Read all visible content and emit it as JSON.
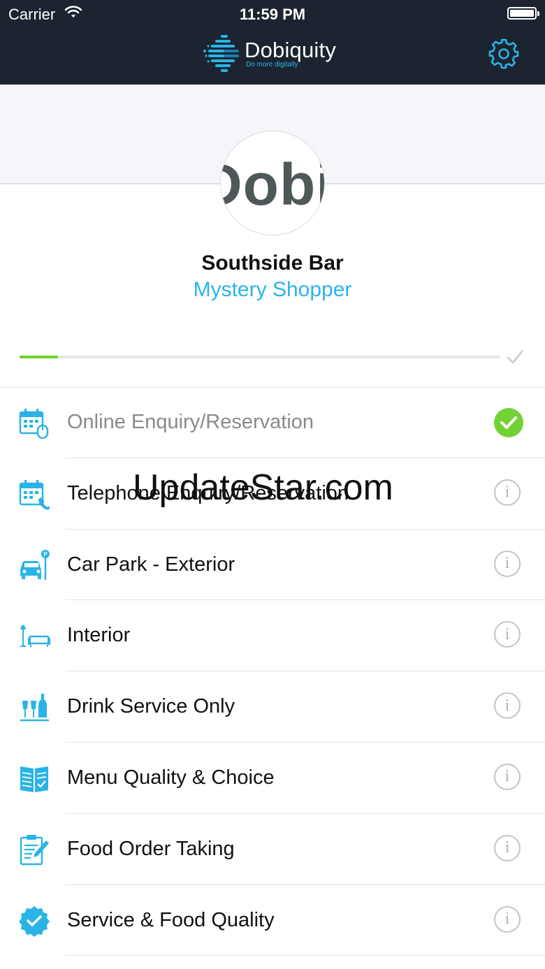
{
  "status_bar": {
    "carrier": "Carrier",
    "time": "11:59 PM"
  },
  "header": {
    "brand_name": "Dobiquity",
    "brand_tagline": "Do more digitally",
    "settings_icon": "gear-icon"
  },
  "profile": {
    "logo_text": "Dobi",
    "venue_name": "Southside Bar",
    "survey_name": "Mystery Shopper"
  },
  "progress": {
    "fraction_complete": 0.08,
    "complete_icon": "checkmark-icon"
  },
  "sections": [
    {
      "label": "Online Enquiry/Reservation",
      "icon": "calendar-mouse-icon",
      "status": "complete",
      "status_icon": "checkmark-circle-icon"
    },
    {
      "label": "Telephone Enquiry/Reservation",
      "icon": "calendar-phone-icon",
      "status": "info",
      "status_icon": "info-icon"
    },
    {
      "label": "Car Park - Exterior",
      "icon": "car-parking-icon",
      "status": "info",
      "status_icon": "info-icon"
    },
    {
      "label": "Interior",
      "icon": "lamp-sofa-icon",
      "status": "info",
      "status_icon": "info-icon"
    },
    {
      "label": "Drink Service Only",
      "icon": "glasses-bottle-icon",
      "status": "info",
      "status_icon": "info-icon"
    },
    {
      "label": "Menu Quality & Choice",
      "icon": "menu-book-icon",
      "status": "info",
      "status_icon": "info-icon"
    },
    {
      "label": "Food Order Taking",
      "icon": "notepad-pen-icon",
      "status": "info",
      "status_icon": "info-icon"
    },
    {
      "label": "Service & Food Quality",
      "icon": "badge-check-icon",
      "status": "info",
      "status_icon": "info-icon"
    }
  ],
  "watermark": "UpdateStar.com",
  "colors": {
    "header_bg": "#1b2430",
    "accent_blue": "#2ab4e6",
    "complete_green": "#74d135"
  }
}
